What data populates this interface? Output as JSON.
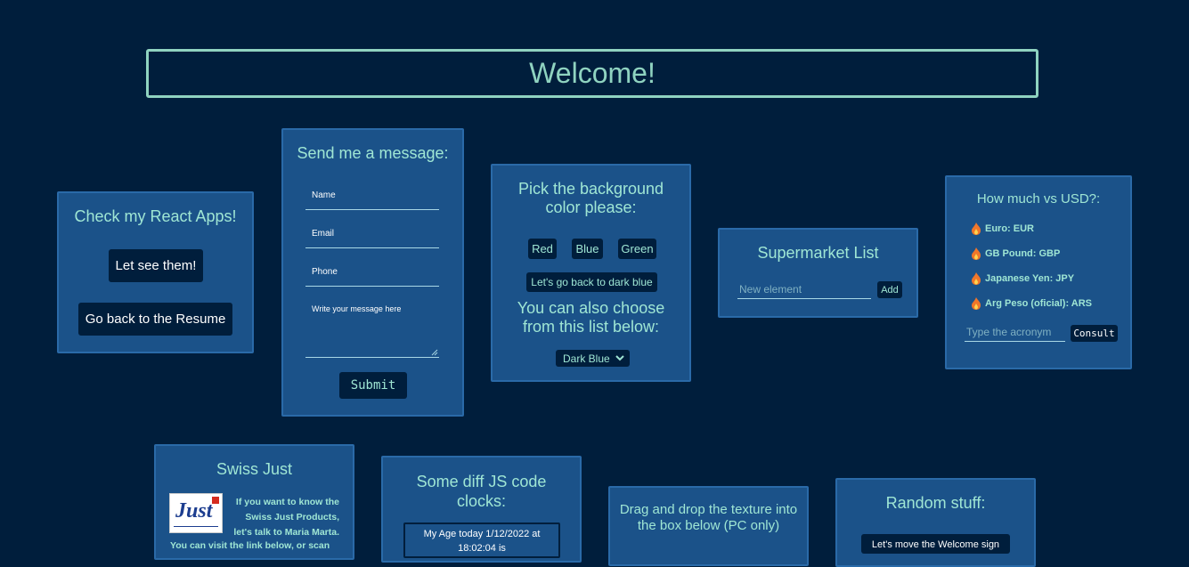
{
  "welcome": {
    "title": "Welcome!"
  },
  "react_apps": {
    "title": "Check my React Apps!",
    "see_button": "Let see them!",
    "resume_button": "Go back to the Resume"
  },
  "message_form": {
    "title": "Send me a message:",
    "name_placeholder": "Name",
    "email_placeholder": "Email",
    "phone_placeholder": "Phone",
    "message_placeholder": "Write your message here",
    "submit_label": "Submit"
  },
  "background_picker": {
    "title": "Pick the background color please:",
    "red_label": "Red",
    "blue_label": "Blue",
    "green_label": "Green",
    "reset_label": "Let's go back to dark blue",
    "list_title": "You can also choose from this list below:",
    "select_value": "Dark Blue"
  },
  "supermarket": {
    "title": "Supermarket List",
    "input_placeholder": "New element",
    "add_label": "Add"
  },
  "currency": {
    "title": "How much vs USD?:",
    "items": [
      "Euro: EUR",
      "GB Pound: GBP",
      "Japanese Yen: JPY",
      "Arg Peso (oficial): ARS"
    ],
    "input_placeholder": "Type the acronym",
    "consult_label": "Consult"
  },
  "swiss_just": {
    "title": "Swiss Just",
    "logo_text": "Just",
    "text_line1": "If you want to know the",
    "text_line2": "Swiss Just Products,",
    "text_line3": "let's talk to Maria Marta.",
    "text_line4": "You can visit the link below, or scan"
  },
  "clocks": {
    "title": "Some diff JS code clocks:",
    "age_text": "My Age today 1/12/2022 at",
    "age_text2": "18:02:04 is"
  },
  "drag_drop": {
    "title": "Drag and drop the texture into the box below (PC only)"
  },
  "random": {
    "title": "Random stuff:",
    "move_label": "Let's move the Welcome sign"
  },
  "colors": {
    "background": "#001e3c",
    "card": "#1b5289",
    "accent": "#9fe6d4",
    "button": "#001e3c"
  }
}
